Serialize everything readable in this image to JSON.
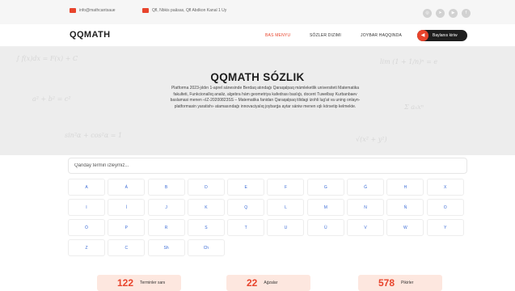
{
  "topbar": {
    "email": "info@mathcantsaue",
    "address": "Qfl, Nbkis paâsas, Qfl Abdkon Kanal 1 Uy",
    "socials": [
      {
        "icon": "instagram-icon",
        "glyph": "◎"
      },
      {
        "icon": "telegram-icon",
        "glyph": "➤"
      },
      {
        "icon": "youtube-icon",
        "glyph": "▶"
      },
      {
        "icon": "facebook-icon",
        "glyph": "f"
      }
    ]
  },
  "header": {
    "logo": "QQMATH",
    "nav": [
      "BAS MENYU",
      "SÓZLER DIZIMI",
      "JOYBAR HAQQINDA"
    ],
    "active_nav": 0,
    "feedback_label": "Baylanıs kiriw",
    "feedback_icon": "megaphone-icon"
  },
  "hero": {
    "title": "QQMATH SÓZLIK",
    "description": "Platforma 2023-jıldın 1-aprel sánesinde Berdaq atındaǵı Qaraqalpaq mámleketlik universiteti Matematika fakulteti, Funkcionallıq analiz, algebra hám geometriya kafedrası baslıǵı, docent Tuwelbay Kurbanbaev baslamasi menen «IZ-20200823SS – Matematika fanidan Qaraqalpaq tilidagi izohli lug'at va uning onlayn- platformasin yaratish» atamasındaǵı innovaciyalıq joybarǵa aytar sániw menen ıqlı kórsetip kelmekte."
  },
  "search": {
    "placeholder": "Qanday termin izleymiz..."
  },
  "letters": [
    "A",
    "Á",
    "B",
    "D",
    "E",
    "F",
    "G",
    "Ǵ",
    "H",
    "X",
    "I",
    "Í",
    "J",
    "K",
    "Q",
    "L",
    "M",
    "N",
    "Ń",
    "O",
    "Ó",
    "P",
    "R",
    "S",
    "T",
    "U",
    "Ú",
    "V",
    "W",
    "Y",
    "Z",
    "C",
    "Sh",
    "Ch"
  ],
  "stats": [
    {
      "value": "122",
      "label": "Terminler sanı"
    },
    {
      "value": "22",
      "label": "Aǵzalar"
    },
    {
      "value": "578",
      "label": "Pikirler"
    }
  ],
  "colors": {
    "accent": "#e8442c",
    "dark": "#1e1e1e",
    "letter": "#3a6bd6",
    "stat_bg": "#fde7df"
  }
}
